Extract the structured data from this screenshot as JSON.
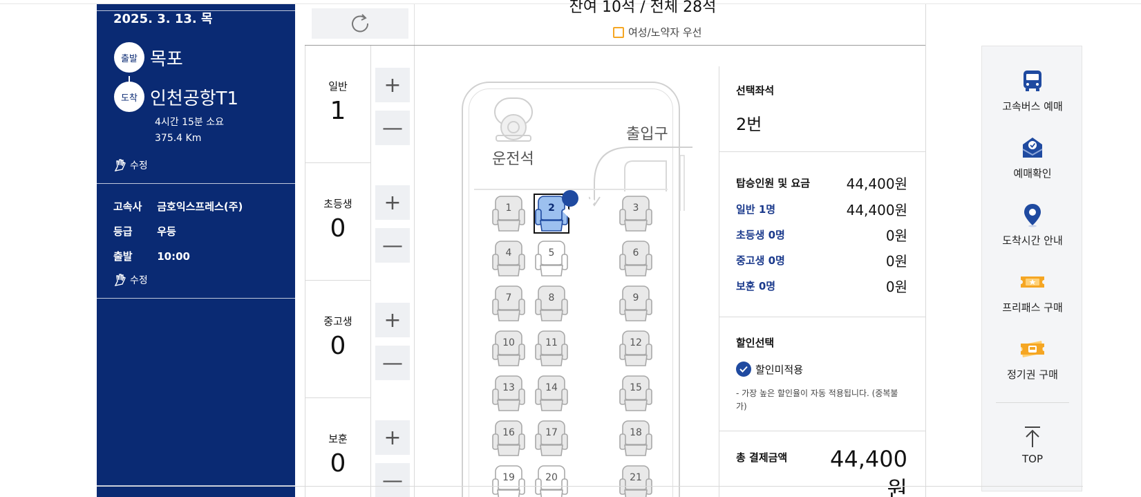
{
  "trip": {
    "date": "2025. 3. 13. 목",
    "departure_badge": "출발",
    "departure": "목포",
    "arrival_badge": "도착",
    "arrival": "인천공항T1",
    "duration": "4시간 15분 소요",
    "distance": "375.4 Km",
    "edit_label": "수정"
  },
  "bus_info": {
    "company_key": "고속사",
    "company": "금호익스프레스(주)",
    "grade_key": "등급",
    "grade": "우등",
    "depart_key": "출발",
    "depart_time": "10:00",
    "edit_label": "수정"
  },
  "passengers": [
    {
      "label": "일반",
      "count": "1"
    },
    {
      "label": "초등생",
      "count": "0"
    },
    {
      "label": "중고생",
      "count": "0"
    },
    {
      "label": "보훈",
      "count": "0"
    }
  ],
  "stepper": {
    "plus": "+",
    "minus": "—"
  },
  "seat_map": {
    "seat_count": "잔여 10석 / 전체 28석",
    "preference_label": "여성/노약자 우선",
    "driver_label": "운전석",
    "entrance_label": "출입구",
    "selected_seat": "2",
    "seats": [
      {
        "num": "1",
        "state": "occupied"
      },
      {
        "num": "2",
        "state": "selected"
      },
      {
        "num": "3",
        "state": "occupied"
      },
      {
        "num": "4",
        "state": "occupied"
      },
      {
        "num": "5",
        "state": "available"
      },
      {
        "num": "6",
        "state": "occupied"
      },
      {
        "num": "7",
        "state": "occupied"
      },
      {
        "num": "8",
        "state": "occupied"
      },
      {
        "num": "9",
        "state": "occupied"
      },
      {
        "num": "10",
        "state": "occupied"
      },
      {
        "num": "11",
        "state": "occupied"
      },
      {
        "num": "12",
        "state": "occupied"
      },
      {
        "num": "13",
        "state": "occupied"
      },
      {
        "num": "14",
        "state": "occupied"
      },
      {
        "num": "15",
        "state": "occupied"
      },
      {
        "num": "16",
        "state": "occupied"
      },
      {
        "num": "17",
        "state": "occupied"
      },
      {
        "num": "18",
        "state": "occupied"
      },
      {
        "num": "19",
        "state": "available"
      },
      {
        "num": "20",
        "state": "available"
      },
      {
        "num": "21",
        "state": "occupied"
      }
    ]
  },
  "summary": {
    "selected_title": "선택좌석",
    "selected_value": "2번",
    "fare_title": "탑승인원 및 요금",
    "fare_total": "44,400원",
    "rows": [
      {
        "label": "일반 1명",
        "amount": "44,400원"
      },
      {
        "label": "초등생 0명",
        "amount": "0원"
      },
      {
        "label": "중고생 0명",
        "amount": "0원"
      },
      {
        "label": "보훈 0명",
        "amount": "0원"
      }
    ],
    "discount_title": "할인선택",
    "discount_option": "할인미적용",
    "discount_note": "- 가장 높은 할인율이 자동 적용됩니다. (중복불가)",
    "total_label": "총 결제금액",
    "total_amount": "44,400원"
  },
  "quick_menu": {
    "items": [
      {
        "label": "고속버스 예매",
        "icon": "bus-icon"
      },
      {
        "label": "예매확인",
        "icon": "ticket-check-icon"
      },
      {
        "label": "도착시간 안내",
        "icon": "location-pin-icon"
      },
      {
        "label": "프리패스 구매",
        "icon": "freepass-icon"
      },
      {
        "label": "정기권 구매",
        "icon": "season-ticket-icon"
      }
    ],
    "top_label": "TOP"
  },
  "colors": {
    "navy": "#0a2a73",
    "accent_blue": "#1f4aa0",
    "label_blue": "#1b3a8c",
    "orange": "#f5a623"
  }
}
